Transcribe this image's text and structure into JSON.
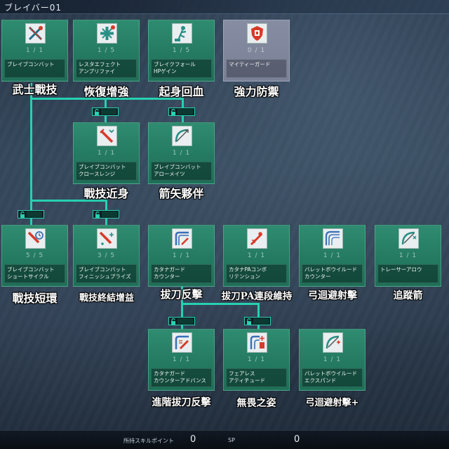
{
  "window": {
    "title": "ブレイバー01"
  },
  "skills": [
    {
      "id": "s1",
      "count": "1 / 1",
      "name_lines": [
        "ブレイブコンバット"
      ],
      "label_zh": "武士戰技",
      "locked": false,
      "icon": "crossed-swords-icon"
    },
    {
      "id": "s2",
      "count": "1 / 5",
      "name_lines": [
        "レスタエフェクト",
        "アンプリファイ"
      ],
      "label_zh": "恢復增強",
      "locked": false,
      "icon": "heal-cross-icon"
    },
    {
      "id": "s3",
      "count": "1 / 5",
      "name_lines": [
        "ブレイクフォール",
        "HPゲイン"
      ],
      "label_zh": "起身回血",
      "locked": false,
      "icon": "breakfall-figure-icon"
    },
    {
      "id": "s4",
      "count": "0 / 1",
      "name_lines": [
        "マイティーガード"
      ],
      "label_zh": "強力防禦",
      "locked": true,
      "icon": "shield-guard-icon"
    },
    {
      "id": "s5",
      "count": "1 / 1",
      "name_lines": [
        "ブレイブコンバット",
        "クロースレンジ"
      ],
      "label_zh": "戰技近身",
      "locked": false,
      "icon": "sword-close-range-icon"
    },
    {
      "id": "s6",
      "count": "1 / 1",
      "name_lines": [
        "ブレイブコンバット",
        "アローメイツ"
      ],
      "label_zh": "箭矢夥伴",
      "locked": false,
      "icon": "bow-arrow-icon"
    },
    {
      "id": "s7",
      "count": "5 / 5",
      "name_lines": [
        "ブレイブコンバット",
        "ショートサイクル"
      ],
      "label_zh": "戰技短環",
      "locked": false,
      "icon": "sword-clock-icon"
    },
    {
      "id": "s8",
      "count": "3 / 5",
      "name_lines": [
        "ブレイブコンバット",
        "フィニッシュプライズ"
      ],
      "label_zh": "戰技終結增益",
      "locked": false,
      "icon": "sword-burst-icon"
    },
    {
      "id": "s9",
      "count": "1 / 1",
      "name_lines": [
        "カタナガード",
        "カウンター"
      ],
      "label_zh": "拔刀反擊",
      "locked": false,
      "icon": "katana-guard-icon"
    },
    {
      "id": "s10",
      "count": "1 / 1",
      "name_lines": [
        "カタナPAコンボ",
        "リテンション"
      ],
      "label_zh": "拔刀PA連段維持",
      "locked": false,
      "icon": "katana-combo-icon"
    },
    {
      "id": "s11",
      "count": "1 / 1",
      "name_lines": [
        "バレットボウイルード",
        "カウンター"
      ],
      "label_zh": "弓迴避射擊",
      "locked": false,
      "icon": "bow-dodge-icon"
    },
    {
      "id": "s12",
      "count": "1 / 1",
      "name_lines": [
        "トレーサーアロウ"
      ],
      "label_zh": "追蹤箭",
      "locked": false,
      "icon": "tracer-arrow-icon"
    },
    {
      "id": "s13",
      "count": "1 / 1",
      "name_lines": [
        "カタナガード",
        "カウンターアドバンス"
      ],
      "label_zh": "進階拔刀反擊",
      "locked": false,
      "icon": "katana-advance-icon"
    },
    {
      "id": "s14",
      "count": "1 / 1",
      "name_lines": [
        "フェアレス",
        "アティチュード"
      ],
      "label_zh": "無畏之姿",
      "locked": false,
      "icon": "fearless-icon"
    },
    {
      "id": "s15",
      "count": "1 / 1",
      "name_lines": [
        "バレットボウイルード",
        "エクスパンド"
      ],
      "label_zh": "弓迴避射擊+",
      "locked": false,
      "icon": "bow-expand-icon"
    }
  ],
  "footer": {
    "skill_points_label": "所持スキルポイント",
    "skill_points_value": "0",
    "sp_label": "SP",
    "sp_value": "0"
  },
  "colors": {
    "card": "#247a61",
    "card_locked": "#7a8196",
    "connector": "#27d0b0",
    "icon_red": "#d83a2a",
    "icon_teal": "#2a8f86",
    "icon_blue": "#3a6fb8"
  }
}
